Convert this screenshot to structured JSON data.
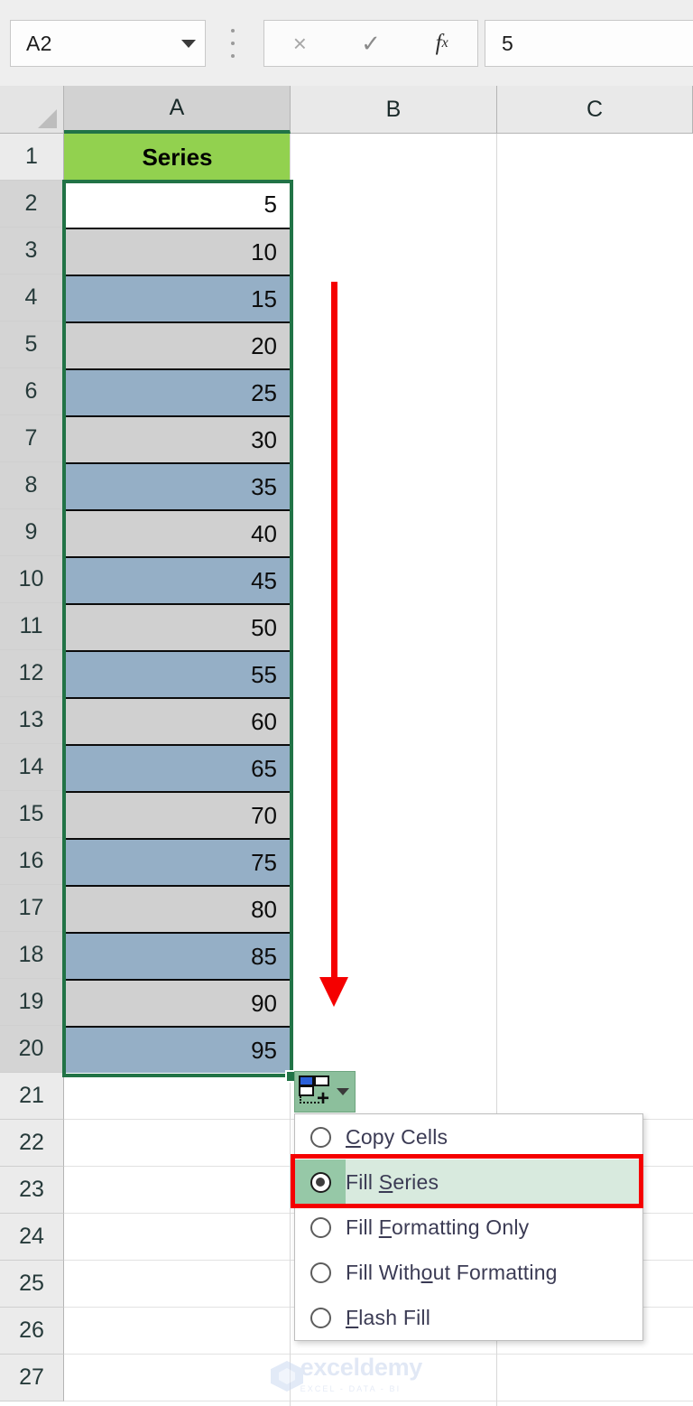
{
  "formula_bar": {
    "name_box_value": "A2",
    "name_box_dropdown_icon": "chevron-down-icon",
    "cancel_icon": "×",
    "enter_icon": "✓",
    "function_icon": "fx",
    "formula_value": "5"
  },
  "grid": {
    "columns": [
      "A",
      "B",
      "C"
    ],
    "selected_column": "A",
    "row_numbers": [
      "1",
      "2",
      "3",
      "4",
      "5",
      "6",
      "7",
      "8",
      "9",
      "10",
      "11",
      "12",
      "13",
      "14",
      "15",
      "16",
      "17",
      "18",
      "19",
      "20",
      "21",
      "22",
      "23",
      "24",
      "25",
      "26",
      "27"
    ],
    "selected_rows": [
      "2",
      "3",
      "4",
      "5",
      "6",
      "7",
      "8",
      "9",
      "10",
      "11",
      "12",
      "13",
      "14",
      "15",
      "16",
      "17",
      "18",
      "19",
      "20"
    ],
    "column_a": {
      "header": "Series",
      "header_fill": "#92D14F",
      "values": [
        "5",
        "10",
        "15",
        "20",
        "25",
        "30",
        "35",
        "40",
        "45",
        "50",
        "55",
        "60",
        "65",
        "70",
        "75",
        "80",
        "85",
        "90",
        "95"
      ],
      "banding": {
        "odd_fill": "#95AFC6",
        "even_fill": "#D0D0D0",
        "active_cell_fill": "#FFFFFF"
      }
    },
    "selection": {
      "range": "A2:A20",
      "border_color": "#217346",
      "fill_handle": "fill-handle"
    }
  },
  "annotation": {
    "arrow_color": "#F50000",
    "highlight_box_color": "#F50000"
  },
  "autofill": {
    "button_icon": "autofill-options-icon",
    "button_dropdown_icon": "chevron-down-icon",
    "button_fill": "#8CBF9C",
    "options": [
      {
        "label_pre": "",
        "label_key": "C",
        "label_post": "opy Cells",
        "selected": false,
        "name": "copy-cells"
      },
      {
        "label_pre": "Fill ",
        "label_key": "S",
        "label_post": "eries",
        "selected": true,
        "name": "fill-series"
      },
      {
        "label_pre": "Fill ",
        "label_key": "F",
        "label_post": "ormatting Only",
        "selected": false,
        "name": "fill-formatting-only"
      },
      {
        "label_pre": "Fill With",
        "label_key": "o",
        "label_post": "ut Formatting",
        "selected": false,
        "name": "fill-without-formatting"
      },
      {
        "label_pre": "",
        "label_key": "F",
        "label_post": "lash Fill",
        "selected": false,
        "name": "flash-fill"
      }
    ],
    "selected_option": "Fill Series"
  },
  "watermark": {
    "name": "exceldemy",
    "tagline": "EXCEL - DATA - BI"
  }
}
